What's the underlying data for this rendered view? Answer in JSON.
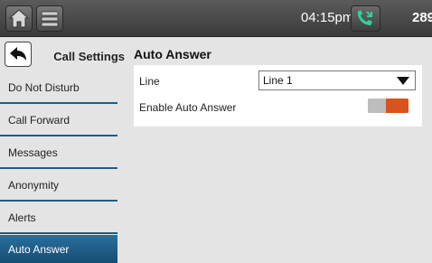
{
  "status_bar": {
    "time": "04:15pm",
    "extension": "289"
  },
  "sidebar": {
    "title": "Call Settings",
    "items": [
      {
        "label": "Do Not Disturb",
        "active": false
      },
      {
        "label": "Call Forward",
        "active": false
      },
      {
        "label": "Messages",
        "active": false
      },
      {
        "label": "Anonymity",
        "active": false
      },
      {
        "label": "Alerts",
        "active": false
      },
      {
        "label": "Auto Answer",
        "active": true
      }
    ]
  },
  "main": {
    "title": "Auto Answer",
    "line_label": "Line",
    "line_value": "Line 1",
    "enable_label": "Enable Auto Answer",
    "enable_on": true
  },
  "colors": {
    "accent": "#1c5c8a",
    "toggle_on": "#d9531e",
    "call_icon": "#2bd3a0"
  }
}
